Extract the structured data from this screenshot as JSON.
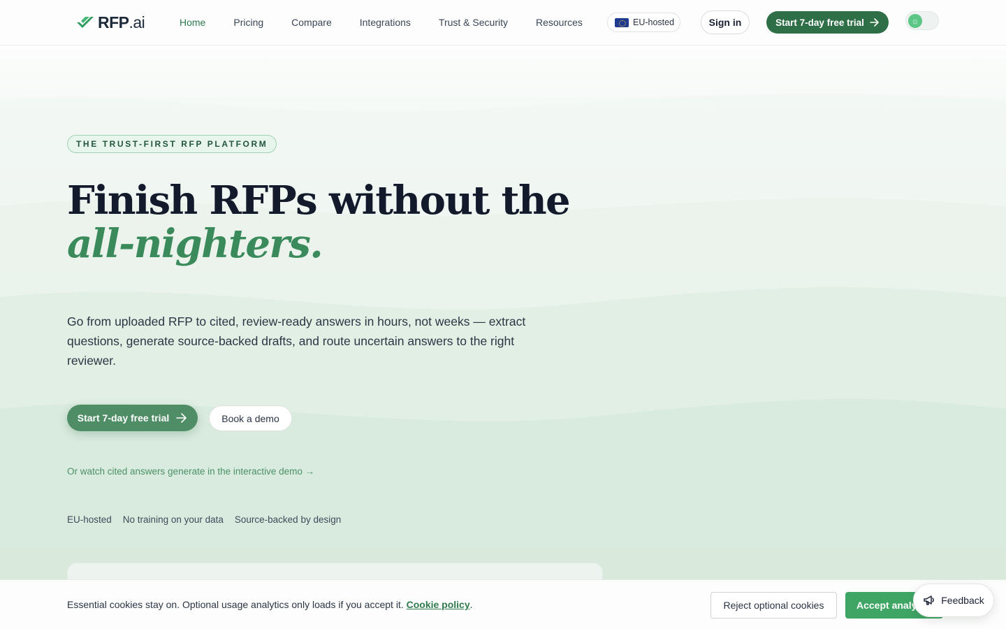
{
  "header": {
    "logo": {
      "text_main": "RFP",
      "text_suffix": ".ai",
      "mark_icon": "stacked-chevrons-icon",
      "color": "#2f9a5e"
    },
    "nav": [
      {
        "label": "Home",
        "active": true
      },
      {
        "label": "Pricing",
        "active": false
      },
      {
        "label": "Compare",
        "active": false
      },
      {
        "label": "Integrations",
        "active": false
      },
      {
        "label": "Trust & Security",
        "active": false
      },
      {
        "label": "Resources",
        "active": false
      }
    ],
    "eu_badge": "EU-hosted",
    "sign_in": "Sign in",
    "trial_button": "Start 7-day free trial",
    "theme_toggle_icon": "sun-icon"
  },
  "hero": {
    "eyebrow": "THE TRUST-FIRST RFP PLATFORM",
    "headline_line1": "Finish RFPs without the",
    "headline_line2": "all-nighters.",
    "subheadline": "Go from uploaded RFP to cited, review-ready answers in hours, not weeks — extract questions, generate source-backed drafts, and route uncertain answers to the right reviewer.",
    "cta_primary": "Start 7-day free trial",
    "cta_secondary": "Book a demo",
    "demo_link": "Or watch cited answers generate in the interactive demo →",
    "trust_items": [
      "EU-hosted",
      "No training on your data",
      "Source-backed by design"
    ]
  },
  "cookie_banner": {
    "text": "Essential cookies stay on. Optional usage analytics only loads if you accept it.",
    "policy_link": "Cookie policy",
    "after_link": ".",
    "reject_button": "Reject optional cookies",
    "accept_button": "Accept analytics"
  },
  "feedback_button": {
    "label": "Feedback",
    "icon": "megaphone-icon"
  },
  "colors": {
    "brand_green": "#2f6f47",
    "accent_green": "#3a8a5c",
    "headline_dark": "#121a2b"
  }
}
